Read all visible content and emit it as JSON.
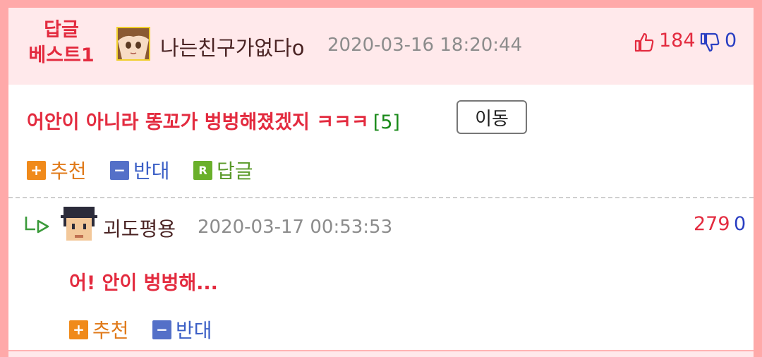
{
  "best_comment": {
    "badge_line1": "답글",
    "badge_line2": "베스트1",
    "author": "나는친구가없다o",
    "date": "2020-03-16 18:20:44",
    "upvotes": "184",
    "downvotes": "0",
    "text": "어안이 아니라 똥꼬가 벙벙해졌겠지 ㅋㅋㅋ",
    "reply_count": "[5]",
    "move_label": "이동",
    "actions": {
      "recommend": "추천",
      "oppose": "반대",
      "reply": "답글",
      "reply_box": "R"
    }
  },
  "reply": {
    "author": "괴도평용",
    "date": "2020-03-17 00:53:53",
    "upvotes": "279",
    "downvotes": "0",
    "text": "어! 안이 벙벙해...",
    "actions": {
      "recommend": "추천",
      "oppose": "반대"
    }
  },
  "icons": {
    "thumbs_up": "thumbs-up-icon",
    "thumbs_down": "thumbs-down-icon",
    "reply_arrow": "reply-arrow-icon",
    "plus": "plus-icon",
    "minus": "minus-icon"
  },
  "colors": {
    "page_border": "#ffa9a9",
    "header_bg": "#ffe9eb",
    "accent_red": "#e32b3f",
    "accent_blue": "#2a3fc2",
    "recommend_orange": "#f08a1a",
    "oppose_blue": "#5470c8",
    "reply_green": "#6ab02b"
  }
}
